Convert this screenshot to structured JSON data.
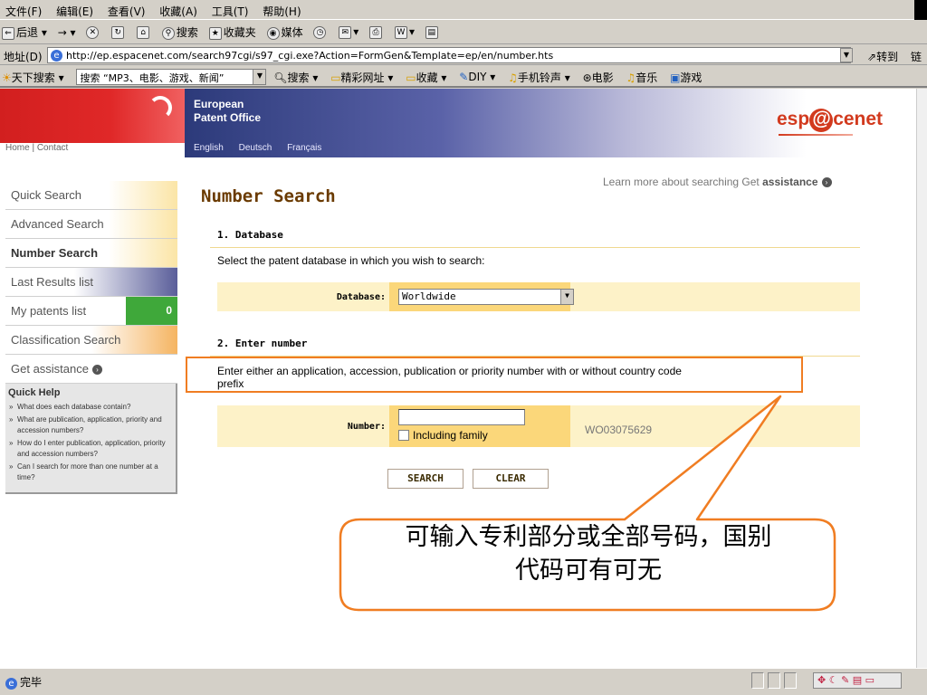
{
  "menubar": [
    "文件(F)",
    "编辑(E)",
    "查看(V)",
    "收藏(A)",
    "工具(T)",
    "帮助(H)"
  ],
  "toolbar": {
    "back": "后退",
    "search": "搜索",
    "favorites": "收藏夹",
    "media": "媒体"
  },
  "addressbar": {
    "label": "地址(D)",
    "url": "http://ep.espacenet.com/search97cgi/s97_cgi.exe?Action=FormGen&Template=ep/en/number.hts",
    "go": "转到",
    "links": "链"
  },
  "searchbar": {
    "label": "天下搜索",
    "field": "搜索 “MP3、电影、游戏、新闻”",
    "search": "搜索",
    "items": [
      "精彩网址",
      "收藏",
      "DIY",
      "手机铃声",
      "电影",
      "音乐",
      "游戏"
    ]
  },
  "header": {
    "org_line1": "European",
    "org_line2": "Patent Office",
    "home_contact": "Home | Contact",
    "languages": [
      "English",
      "Deutsch",
      "Français"
    ],
    "brand_pre": "esp",
    "brand_a": "@",
    "brand_post": "cenet"
  },
  "sidebar": {
    "items": [
      {
        "label": "Quick Search"
      },
      {
        "label": "Advanced Search"
      },
      {
        "label": "Number Search"
      },
      {
        "label": "Last Results list"
      },
      {
        "label": "My patents list",
        "badge": "0"
      },
      {
        "label": "Classification Search"
      },
      {
        "label": "Get assistance"
      }
    ],
    "quick_help": {
      "title": "Quick Help",
      "items": [
        "What does each database contain?",
        "What are publication, application, priority and accession numbers?",
        "How do I enter publication, application, priority and accession numbers?",
        "Can I search for more than one number at a time?"
      ]
    }
  },
  "main": {
    "learn_more": "Learn more about searching Get",
    "learn_more_bold": "assistance",
    "title": "Number Search",
    "section1": {
      "title": "1. Database",
      "text": "Select the patent database in which you wish to search:",
      "label": "Database:",
      "value": "Worldwide"
    },
    "section2": {
      "title": "2. Enter number",
      "text_line1": "Enter either an application, accession, publication or priority number with or without country code",
      "text_line2": "prefix",
      "label": "Number:",
      "number_value": "",
      "checkbox_label": "Including family",
      "example": "WO03075629"
    },
    "search_button": "SEARCH",
    "clear_button": "CLEAR"
  },
  "callout": {
    "line1": "可输入专利部分或全部号码，国别",
    "line2": "代码可有可无"
  },
  "statusbar": {
    "text": "完毕"
  },
  "colors": {
    "callout_border": "#f07d22",
    "title_brown": "#6a3a00",
    "epo_red": "#d21f1f",
    "form_bg": "#fdf2c8"
  }
}
